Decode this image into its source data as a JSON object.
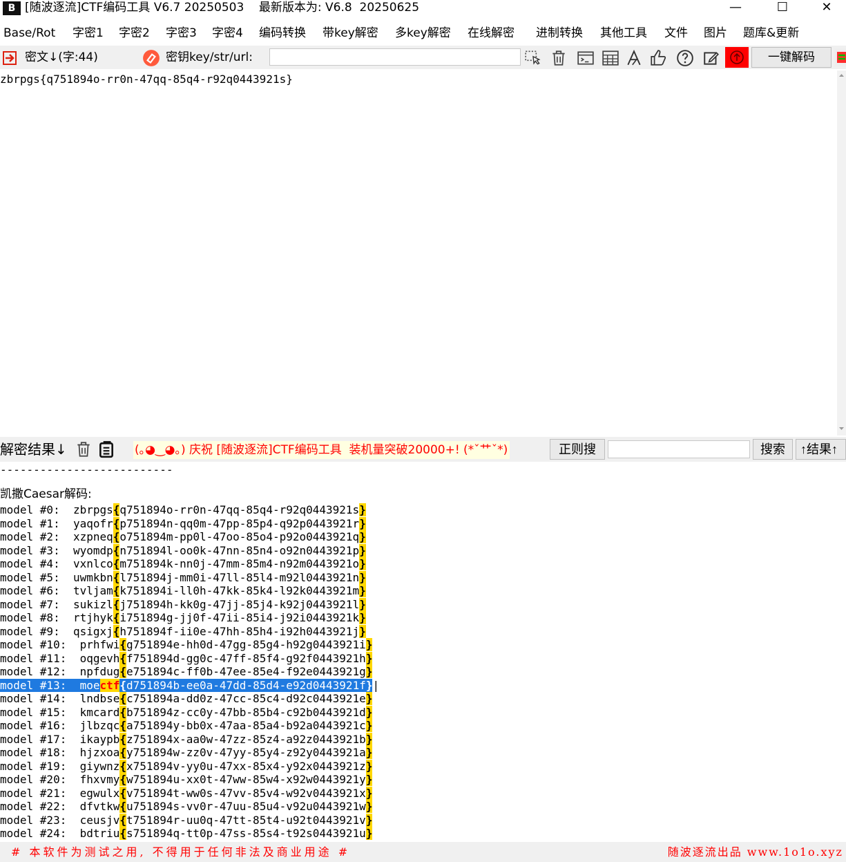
{
  "window": {
    "title": "[随波逐流]CTF编码工具 V6.7 20250503    最新版本为: V6.8  20250625",
    "icon_text": "B",
    "minimize": "—",
    "maximize": "☐",
    "close": "✕"
  },
  "menu": [
    "Base/Rot",
    "字密1",
    "字密2",
    "字密3",
    "字密4",
    "编码转换",
    "带key解密",
    "多key解密",
    "在线解密",
    "进制转换",
    "其他工具",
    "文件",
    "图片",
    "题库&更新"
  ],
  "toolbar": {
    "cipher_label": "密文↓(字:44)",
    "key_label": "密钥key/str/url:",
    "key_value": "",
    "decode_button": "一键解码",
    "icons": [
      "cursor-select-icon",
      "trash-icon",
      "terminal-icon",
      "table-icon",
      "font-icon",
      "thumbs-up-icon",
      "help-icon",
      "edit-icon"
    ]
  },
  "cipher_text": "zbrpgs{q751894o-rr0n-47qq-85q4-r92q0443921s}",
  "result_bar": {
    "label": "解密结果↓",
    "banner": "(｡◕‿◕｡) 庆祝 [随波逐流]CTF编码工具  装机量突破20000+! (*ˇ艹ˇ*)",
    "regex_button": "正则搜",
    "search_value": "",
    "search_button": "搜索",
    "result_up_button": "↑结果↑"
  },
  "results": {
    "separator": "--------------------------",
    "caesar_title": "凯撒Caesar解码:",
    "lines": [
      {
        "prefix": "model #0:  zbrpgs",
        "body": "q751894o-rr0n-47qq-85q4-r92q0443921s"
      },
      {
        "prefix": "model #1:  yaqofr",
        "body": "p751894n-qq0m-47pp-85p4-q92p0443921r"
      },
      {
        "prefix": "model #2:  xzpneq",
        "body": "o751894m-pp0l-47oo-85o4-p92o0443921q"
      },
      {
        "prefix": "model #3:  wyomdp",
        "body": "n751894l-oo0k-47nn-85n4-o92n0443921p"
      },
      {
        "prefix": "model #4:  vxnlco",
        "body": "m751894k-nn0j-47mm-85m4-n92m0443921o"
      },
      {
        "prefix": "model #5:  uwmkbn",
        "body": "l751894j-mm0i-47ll-85l4-m92l0443921n"
      },
      {
        "prefix": "model #6:  tvljam",
        "body": "k751894i-ll0h-47kk-85k4-l92k0443921m"
      },
      {
        "prefix": "model #7:  sukizl",
        "body": "j751894h-kk0g-47jj-85j4-k92j0443921l"
      },
      {
        "prefix": "model #8:  rtjhyk",
        "body": "i751894g-jj0f-47ii-85i4-j92i0443921k"
      },
      {
        "prefix": "model #9:  qsigxj",
        "body": "h751894f-ii0e-47hh-85h4-i92h0443921j"
      },
      {
        "prefix": "model #10:  prhfwi",
        "body": "g751894e-hh0d-47gg-85g4-h92g0443921i"
      },
      {
        "prefix": "model #11:  oqgevh",
        "body": "f751894d-gg0c-47ff-85f4-g92f0443921h"
      },
      {
        "prefix": "model #12:  npfdug",
        "body": "e751894c-ff0b-47ee-85e4-f92e0443921g"
      },
      {
        "prefix": "model #13:  moe",
        "ctf": "ctf",
        "body": "d751894b-ee0a-47dd-85d4-e92d0443921f",
        "selected": true
      },
      {
        "prefix": "model #14:  lndbse",
        "body": "c751894a-dd0z-47cc-85c4-d92c0443921e"
      },
      {
        "prefix": "model #15:  kmcard",
        "body": "b751894z-cc0y-47bb-85b4-c92b0443921d"
      },
      {
        "prefix": "model #16:  jlbzqc",
        "body": "a751894y-bb0x-47aa-85a4-b92a0443921c"
      },
      {
        "prefix": "model #17:  ikaypb",
        "body": "z751894x-aa0w-47zz-85z4-a92z0443921b"
      },
      {
        "prefix": "model #18:  hjzxoa",
        "body": "y751894w-zz0v-47yy-85y4-z92y0443921a"
      },
      {
        "prefix": "model #19:  giywnz",
        "body": "x751894v-yy0u-47xx-85x4-y92x0443921z"
      },
      {
        "prefix": "model #20:  fhxvmy",
        "body": "w751894u-xx0t-47ww-85w4-x92w0443921y"
      },
      {
        "prefix": "model #21:  egwulx",
        "body": "v751894t-ww0s-47vv-85v4-w92v0443921x"
      },
      {
        "prefix": "model #22:  dfvtkw",
        "body": "u751894s-vv0r-47uu-85u4-v92u0443921w"
      },
      {
        "prefix": "model #23:  ceusjv",
        "body": "t751894r-uu0q-47tt-85t4-u92t0443921v"
      },
      {
        "prefix": "model #24:  bdtriu",
        "body": "s751894q-tt0p-47ss-85s4-t92s0443921u"
      }
    ]
  },
  "status": {
    "left": "# 本软件为测试之用, 不得用于任何非法及商业用途 #",
    "right": "随波逐流出品 www.1o1o.xyz"
  },
  "colors": {
    "highlight_yellow": "#ffd700",
    "selection_blue": "#1f7ae0",
    "alert_red": "#ff0000"
  }
}
